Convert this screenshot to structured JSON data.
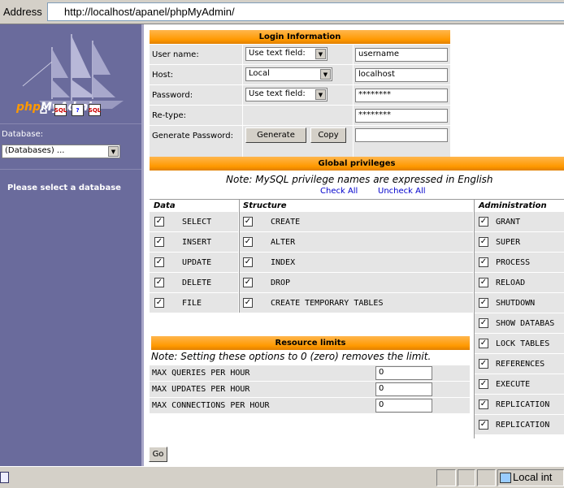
{
  "browser": {
    "address_label": "Address",
    "url": "http://localhost/apanel/phpMyAdmin/",
    "status_zone": "Local int"
  },
  "sidebar": {
    "logo_php": "php",
    "logo_myadmin": "MyAdmin",
    "icons": [
      "home-icon",
      "sql-icon",
      "help-icon",
      "sql-query-icon"
    ],
    "icon_labels": {
      "sql": "SQL",
      "help": "?",
      "query": "SQL"
    },
    "database_label": "Database:",
    "database_select": "(Databases) ...",
    "message": "Please select a database"
  },
  "login": {
    "title": "Login Information",
    "username_label": "User name:",
    "username_type": "Use text field:",
    "username_value": "username",
    "host_label": "Host:",
    "host_type": "Local",
    "host_value": "localhost",
    "password_label": "Password:",
    "password_type": "Use text field:",
    "password_value": "********",
    "retype_label": "Re-type:",
    "retype_value": "********",
    "genpass_label": "Generate Password:",
    "generate_button": "Generate",
    "copy_button": "Copy",
    "genpass_value": ""
  },
  "privileges": {
    "title": "Global privileges",
    "note": "Note: MySQL privilege names are expressed in English",
    "check_all": "Check All",
    "uncheck_all": "Uncheck All",
    "data_header": "Data",
    "structure_header": "Structure",
    "admin_header": "Administration",
    "data": [
      "SELECT",
      "INSERT",
      "UPDATE",
      "DELETE",
      "FILE"
    ],
    "structure": [
      "CREATE",
      "ALTER",
      "INDEX",
      "DROP",
      "CREATE TEMPORARY TABLES"
    ],
    "admin": [
      "GRANT",
      "SUPER",
      "PROCESS",
      "RELOAD",
      "SHUTDOWN",
      "SHOW DATABAS",
      "LOCK TABLES",
      "REFERENCES",
      "EXECUTE",
      "REPLICATION",
      "REPLICATION"
    ],
    "check_mark": "✓"
  },
  "resources": {
    "title": "Resource limits",
    "note": "Note: Setting these options to 0 (zero) removes the limit.",
    "rows": [
      {
        "label": "MAX QUERIES PER HOUR",
        "value": "0"
      },
      {
        "label": "MAX UPDATES PER HOUR",
        "value": "0"
      },
      {
        "label": "MAX CONNECTIONS PER HOUR",
        "value": "0"
      }
    ]
  },
  "go_button": "Go",
  "colors": {
    "sidebar": "#6a6b9c",
    "header": "#ff9900",
    "row": "#e5e5e5",
    "link": "#0000cc"
  }
}
